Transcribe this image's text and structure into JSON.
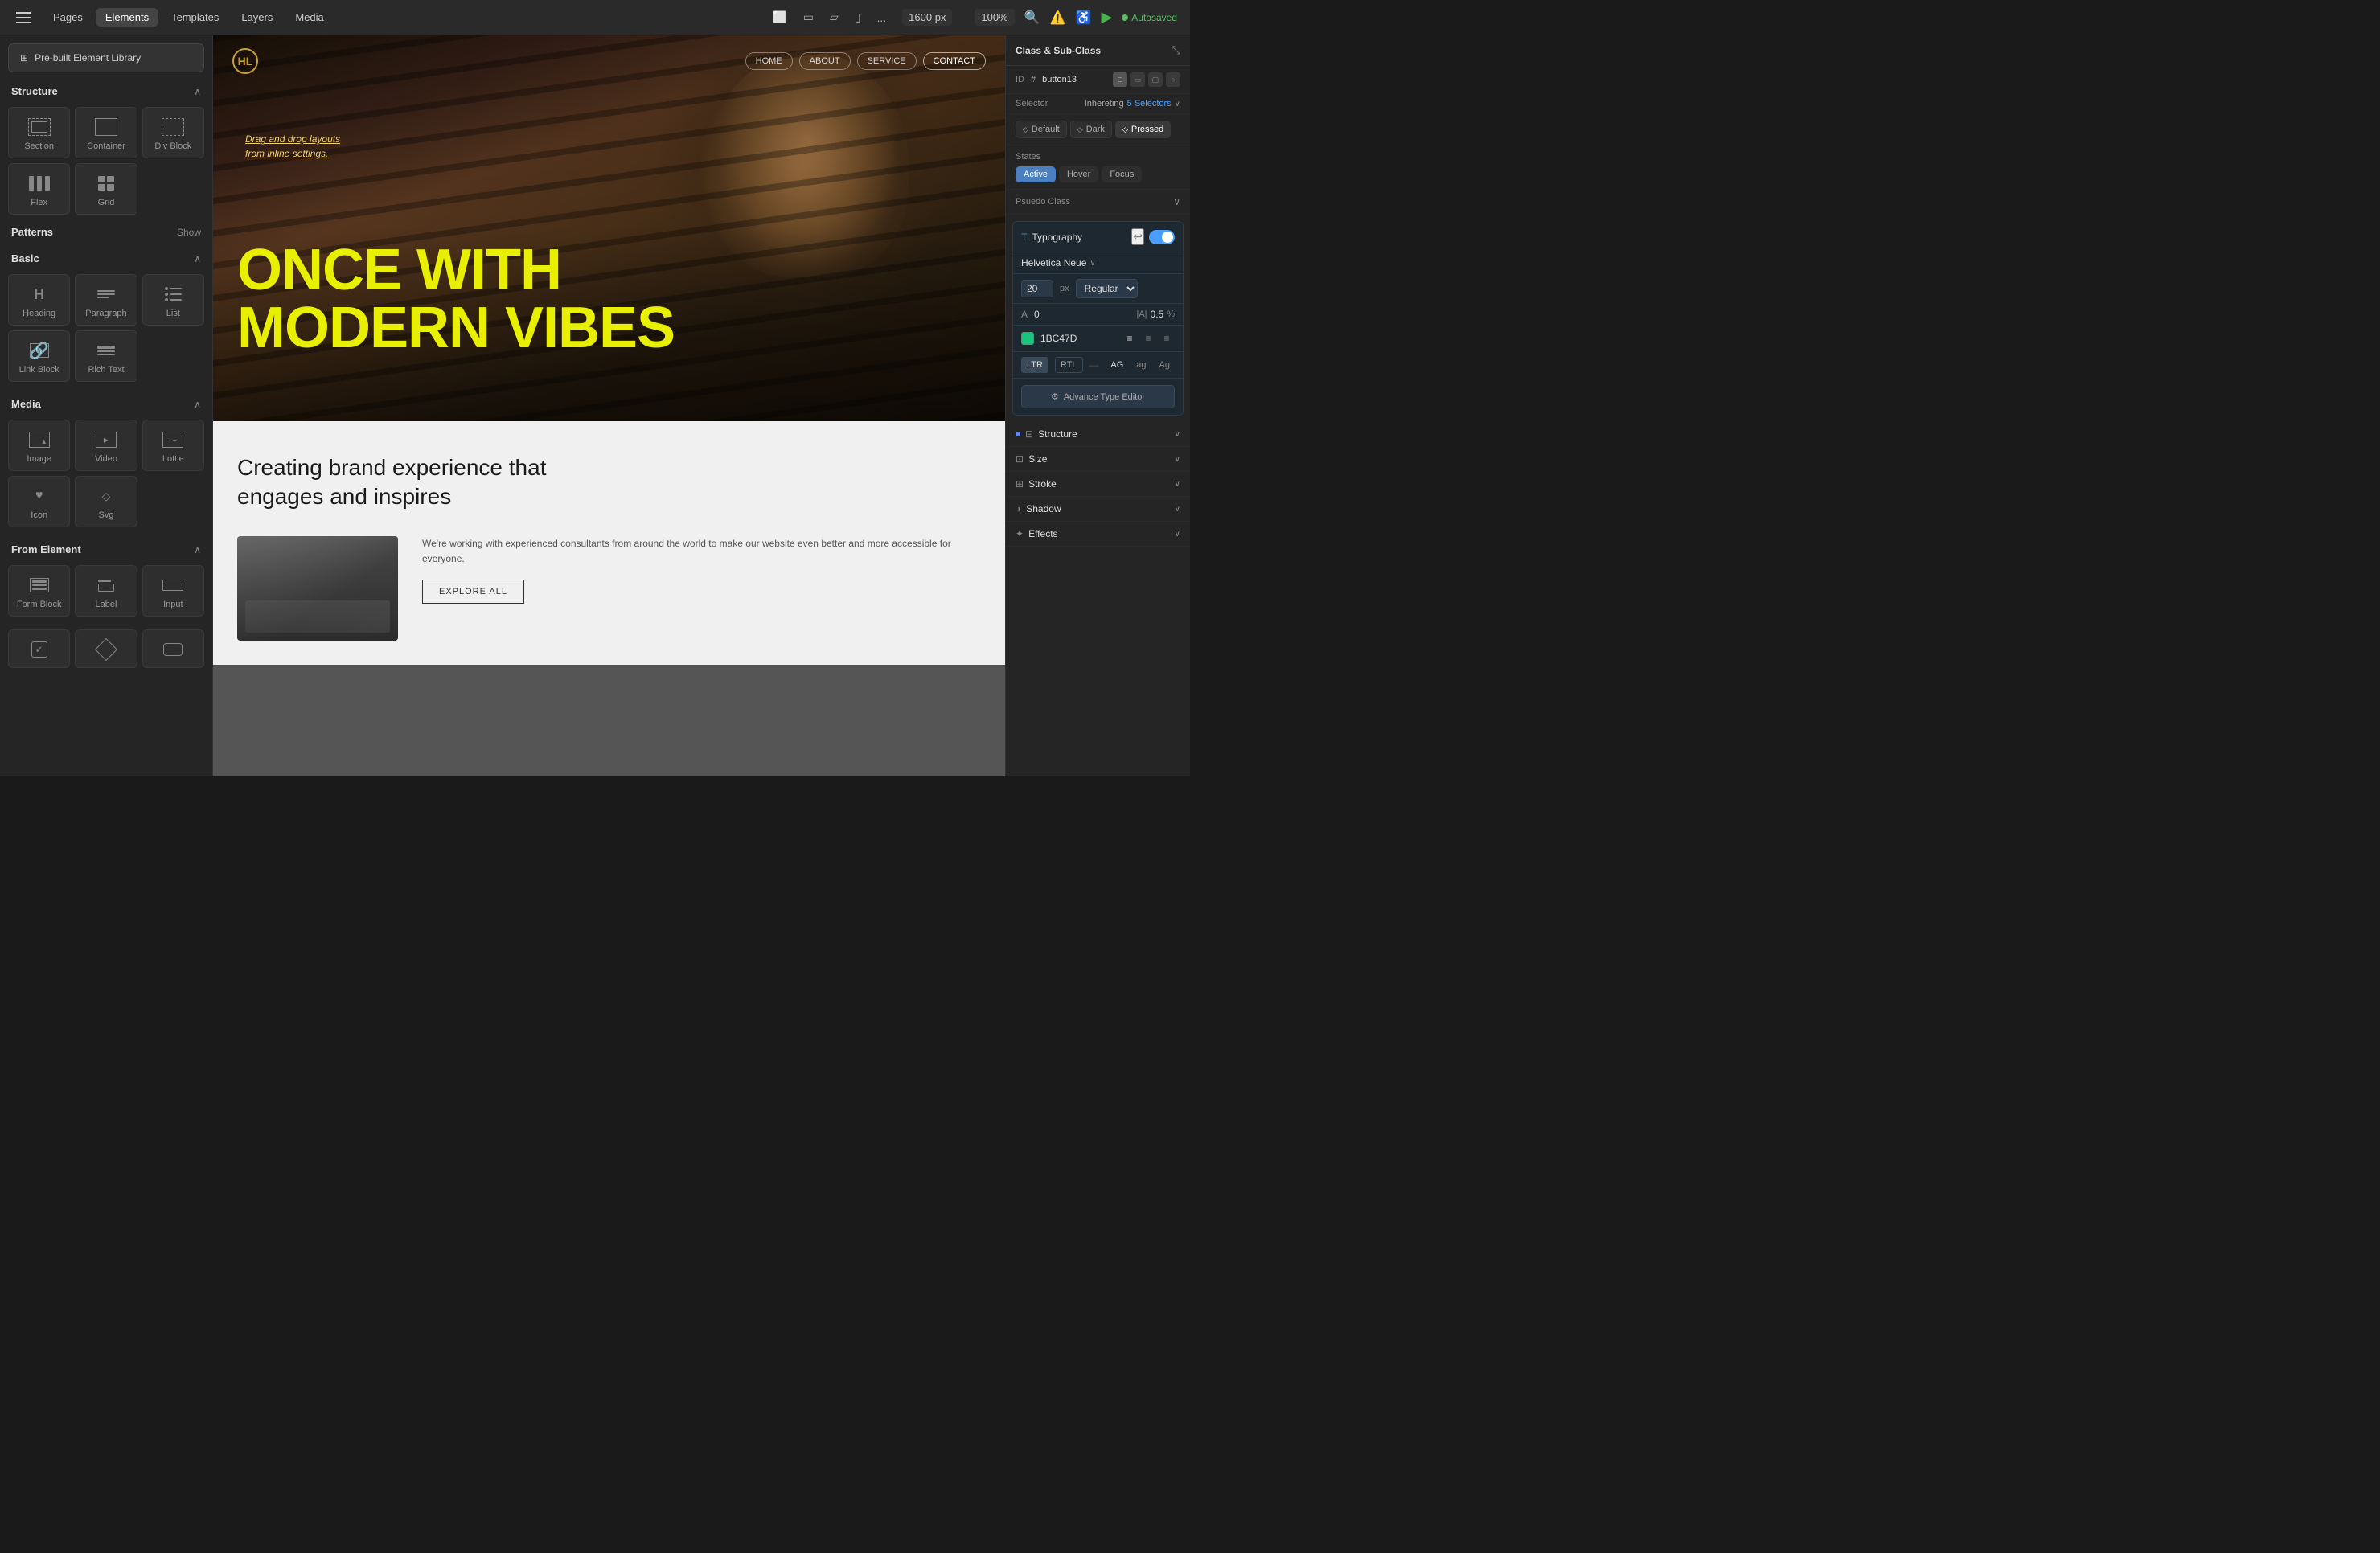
{
  "topBar": {
    "hamburger": "menu",
    "navItems": [
      {
        "label": "Pages",
        "active": false
      },
      {
        "label": "Elements",
        "active": true
      },
      {
        "label": "Templates",
        "active": false
      },
      {
        "label": "Layers",
        "active": false
      },
      {
        "label": "Media",
        "active": false
      }
    ],
    "viewportSize": "1600 px",
    "zoomLevel": "100%",
    "moreLabel": "...",
    "autosaved": "Autosaved"
  },
  "leftPanel": {
    "libraryBtn": "Pre-built Element Library",
    "sections": {
      "structure": {
        "title": "Structure",
        "elements": [
          {
            "label": "Section",
            "icon": "section"
          },
          {
            "label": "Container",
            "icon": "container"
          },
          {
            "label": "Div Block",
            "icon": "div-block"
          },
          {
            "label": "Flex",
            "icon": "flex"
          },
          {
            "label": "Grid",
            "icon": "grid"
          }
        ],
        "patternsLabel": "Patterns",
        "showLabel": "Show"
      },
      "basic": {
        "title": "Basic",
        "elements": [
          {
            "label": "Heading",
            "icon": "heading"
          },
          {
            "label": "Paragraph",
            "icon": "paragraph"
          },
          {
            "label": "List",
            "icon": "list"
          },
          {
            "label": "Link Block",
            "icon": "link-block"
          },
          {
            "label": "Rich Text",
            "icon": "rich-text"
          }
        ]
      },
      "media": {
        "title": "Media",
        "elements": [
          {
            "label": "Image",
            "icon": "image"
          },
          {
            "label": "Video",
            "icon": "video"
          },
          {
            "label": "Lottie",
            "icon": "lottie"
          },
          {
            "label": "Icon",
            "icon": "icon"
          },
          {
            "label": "Svg",
            "icon": "svg"
          }
        ]
      },
      "fromElement": {
        "title": "From Element",
        "elements": [
          {
            "label": "Form Block",
            "icon": "form"
          },
          {
            "label": "Label",
            "icon": "label"
          },
          {
            "label": "Input",
            "icon": "input"
          }
        ],
        "bottomIcons": [
          {
            "label": "checkbox",
            "icon": "checkbox"
          },
          {
            "label": "diamond",
            "icon": "diamond-shape"
          },
          {
            "label": "rounded",
            "icon": "rounded-rect"
          }
        ]
      }
    }
  },
  "canvas": {
    "website": {
      "nav": {
        "logoText": "HL",
        "links": [
          "HOME",
          "ABOUT",
          "SERVICE",
          "CONTACT"
        ]
      },
      "hero": {
        "dragDropText": "Drag and drop layouts\nfrom inline settings.",
        "headline": "ONCE WITH\nMODERN VIBES"
      },
      "tagline": "Creating brand experience that engages and inspires",
      "description": "We're working with experienced consultants from around the world to make our website even better and more accessible for everyone.",
      "exploreBtn": "EXPLORE ALL"
    }
  },
  "rightPanel": {
    "title": "Class & Sub-Class",
    "id": {
      "label": "ID",
      "hash": "#",
      "value": "button13"
    },
    "selector": {
      "label": "Selector",
      "inhereting": "Inhereting",
      "selectorsCount": "5 Selectors"
    },
    "classButtons": [
      {
        "label": "Default",
        "active": false,
        "icon": "◇"
      },
      {
        "label": "Dark",
        "active": false,
        "icon": "◇"
      },
      {
        "label": "Pressed",
        "active": true,
        "icon": "◇"
      }
    ],
    "states": {
      "label": "States",
      "buttons": [
        {
          "label": "Active",
          "active": true
        },
        {
          "label": "Hover",
          "active": false
        },
        {
          "label": "Focus",
          "active": false
        }
      ]
    },
    "pseudoClass": "Psuedo Class",
    "typography": {
      "title": "Typography",
      "fontFamily": "Helvetica Neue",
      "fontSize": "20",
      "fontUnit": "px",
      "fontWeight": "Regular",
      "letterSpacing": "0",
      "wordSpacing": "0.5",
      "wordSpacingUnit": "%",
      "colorHex": "1BC47D",
      "alignment": [
        "left",
        "center",
        "right"
      ],
      "direction": {
        "ltr": "LTR",
        "rtl": "RTL"
      },
      "caseOptions": [
        "AG",
        "ag",
        "Ag"
      ],
      "advanceTypeBtn": "Advance Type Editor"
    },
    "structureSections": [
      {
        "label": "Structure",
        "icon": "structure"
      },
      {
        "label": "Size",
        "icon": "size"
      },
      {
        "label": "Stroke",
        "icon": "stroke"
      },
      {
        "label": "Shadow",
        "icon": "shadow"
      },
      {
        "label": "Effects",
        "icon": "effects"
      }
    ]
  }
}
